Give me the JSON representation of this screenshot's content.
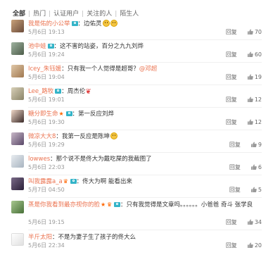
{
  "tabs": [
    {
      "label": "全部",
      "active": true
    },
    {
      "label": "热门",
      "active": false
    },
    {
      "label": "认证用户",
      "active": false
    },
    {
      "label": "关注的人",
      "active": false
    },
    {
      "label": "陌生人",
      "active": false
    }
  ],
  "colors": {
    "username": "#eb7350",
    "badge": "#34b4c8",
    "meta": "#999999"
  },
  "comments": [
    {
      "user": "我是佑的小公举",
      "text": "：边佑灵",
      "time": "5月6日 19:13",
      "reply": "回复",
      "likes": "70",
      "emoji": "smile",
      "emoji2": "smile"
    },
    {
      "user": "池中蛙",
      "text": "：这不害的站姿，百分之九九刘烨",
      "time": "5月6日 19:24",
      "reply": "回复",
      "likes": "60"
    },
    {
      "user": "Icey_朱钰媛",
      "text": "：只有我一个人觉得是超哥？",
      "mention": "@邓超",
      "time": "5月6日 19:04",
      "reply": "回复",
      "likes": "19"
    },
    {
      "user": "Lee_路牧",
      "text": "：周杰伦",
      "time": "5月6日 19:01",
      "reply": "回复",
      "likes": "12"
    },
    {
      "user": "糖分即生命",
      "text": "：第一反应刘烨",
      "time": "5月6日 19:30",
      "reply": "回复",
      "likes": "12"
    },
    {
      "user": "微凉大大8",
      "text": "：我第一反应是陈坤",
      "time": "5月6日 19:29",
      "reply": "回复",
      "likes": "9"
    },
    {
      "user": "lowwes",
      "text": "：那个说不是佟大为戴吃屎的我截图了",
      "time": "5月6日 22:03",
      "reply": "回复",
      "likes": "6"
    },
    {
      "user": "叫我露露a_a",
      "text": "：佟大为啊 能看出来",
      "time": "5月7日 04:50",
      "reply": "回复",
      "likes": "5"
    },
    {
      "user": "蒸是你我看到最亦视你的脸",
      "text": "：只有我觉得是文章吗。。。。。。小爸爸 奇斗 张学良",
      "time": "5月6日 19:15",
      "reply": "回复",
      "likes": "34"
    },
    {
      "user": "半斤太阳",
      "text": "：不是为妻子生了孩子的佟大么",
      "time": "5月6日 22:34",
      "reply": "回复",
      "likes": "20"
    }
  ]
}
